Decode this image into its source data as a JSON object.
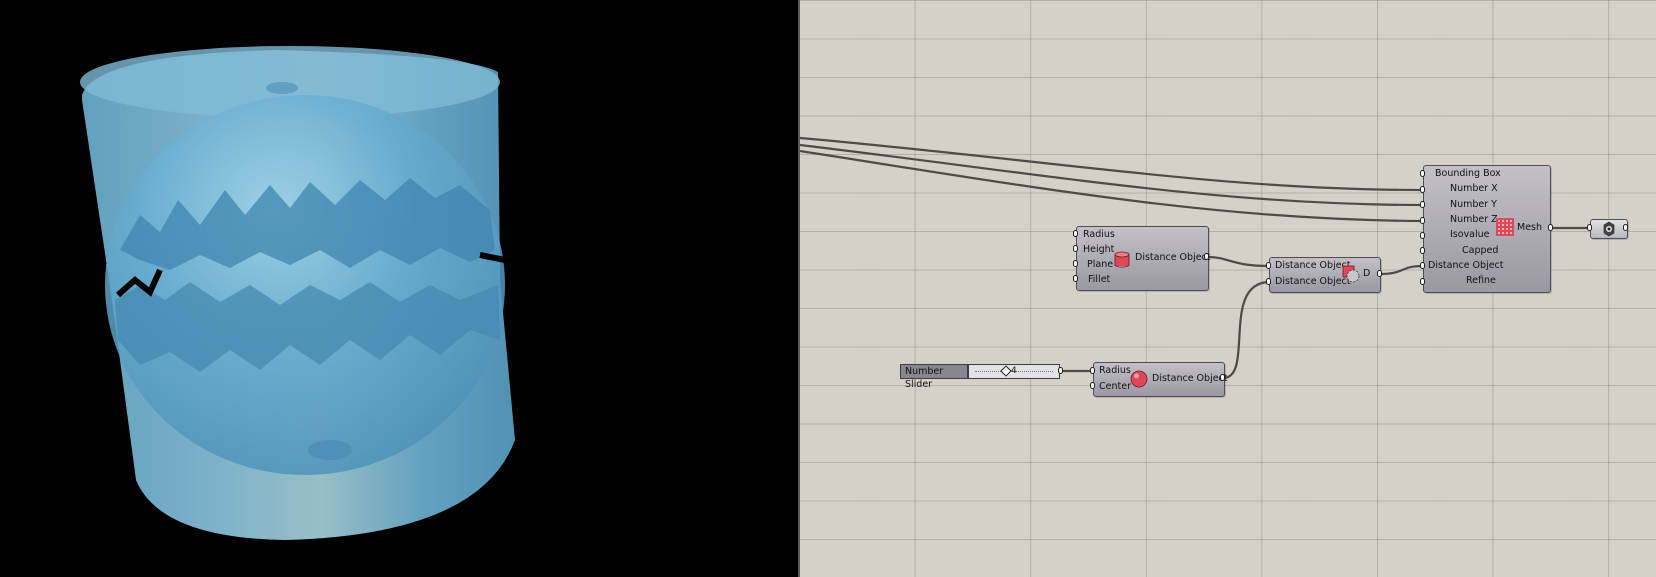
{
  "canvas": {
    "cylinder_component": {
      "inputs": [
        "Radius",
        "Height",
        "Plane",
        "Fillet"
      ],
      "output": "Distance Object",
      "icon": "cylinder-icon"
    },
    "sphere_component": {
      "inputs": [
        "Radius",
        "Center"
      ],
      "output": "Distance Object",
      "icon": "sphere-icon"
    },
    "difference_component": {
      "inputs": [
        "Distance Object",
        "Distance Object"
      ],
      "output": "D",
      "icon": "difference-icon"
    },
    "mesh_component": {
      "inputs": [
        "Bounding Box",
        "Number X",
        "Number Y",
        "Number Z",
        "Isovalue",
        "Capped",
        "Distance Object",
        "Refine"
      ],
      "output": "Mesh",
      "icon": "mesh-grid-icon"
    },
    "number_slider": {
      "label": "Number Slider",
      "value": "4"
    },
    "preview_node": {
      "icon": "eye-icon"
    }
  },
  "colors": {
    "canvas_bg": "#d5d1c9",
    "component_fill": "#aeacb5",
    "viewport_bg": "#000000",
    "mesh_color": "#5aa6c8",
    "icon_red": "#e04858"
  }
}
